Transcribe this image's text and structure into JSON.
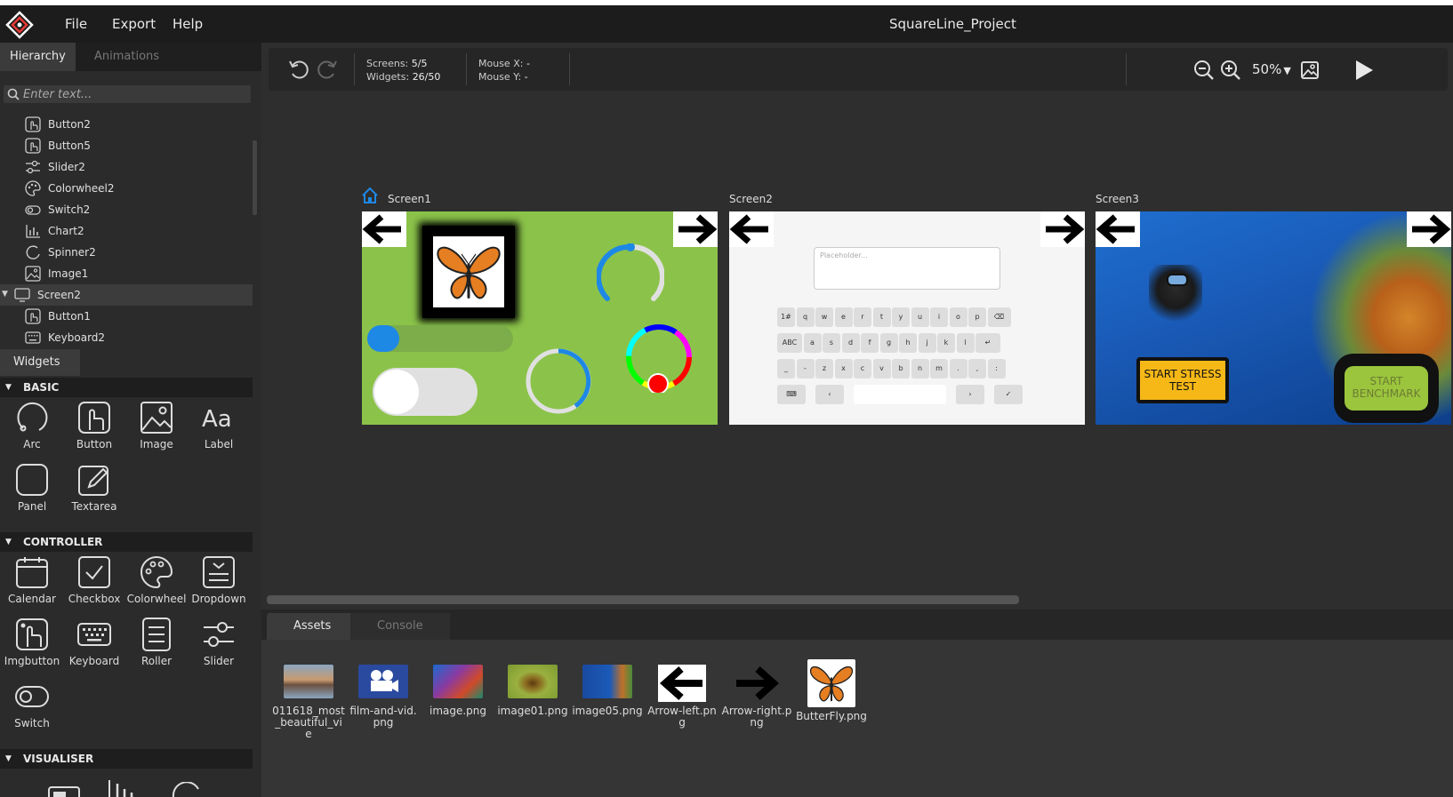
{
  "app": {
    "title": "SquareLine_Project",
    "menu": [
      "File",
      "Export",
      "Help"
    ]
  },
  "left_panel": {
    "tabs": [
      "Hierarchy",
      "Animations"
    ],
    "search_placeholder": "Enter text...",
    "hierarchy": [
      {
        "label": "Button2",
        "icon": "button-icon"
      },
      {
        "label": "Button5",
        "icon": "button-icon"
      },
      {
        "label": "Slider2",
        "icon": "slider-icon"
      },
      {
        "label": "Colorwheel2",
        "icon": "colorwheel-icon"
      },
      {
        "label": "Switch2",
        "icon": "switch-icon"
      },
      {
        "label": "Chart2",
        "icon": "chart-icon"
      },
      {
        "label": "Spinner2",
        "icon": "spinner-icon"
      },
      {
        "label": "Image1",
        "icon": "image-icon"
      },
      {
        "label": "Screen2",
        "icon": "screen-icon",
        "selected": true
      },
      {
        "label": "Button1",
        "icon": "button-icon"
      },
      {
        "label": "Keyboard2",
        "icon": "keyboard-icon"
      }
    ],
    "widgets_tab": "Widgets",
    "sections": {
      "basic": "BASIC",
      "controller": "CONTROLLER",
      "visualiser": "VISUALISER"
    },
    "basic_widgets": [
      "Arc",
      "Button",
      "Image",
      "Label",
      "Panel",
      "Textarea"
    ],
    "controller_widgets": [
      "Calendar",
      "Checkbox",
      "Colorwheel",
      "Dropdown",
      "Imgbutton",
      "Keyboard",
      "Roller",
      "Slider",
      "Switch"
    ]
  },
  "toolbar": {
    "screens_label": "Screens:",
    "screens_value": "5/5",
    "widgets_label": "Widgets:",
    "widgets_value": "26/50",
    "mouse_x_label": "Mouse X:",
    "mouse_x_value": "-",
    "mouse_y_label": "Mouse Y:",
    "mouse_y_value": "-",
    "zoom": "50%"
  },
  "canvas": {
    "screens": [
      {
        "label": "Screen1",
        "home": true
      },
      {
        "label": "Screen2"
      },
      {
        "label": "Screen3"
      }
    ],
    "textarea_placeholder": "Placeholder...",
    "keyboard_rows": [
      [
        "1#",
        "q",
        "w",
        "e",
        "r",
        "t",
        "y",
        "u",
        "i",
        "o",
        "p",
        "⌫"
      ],
      [
        "ABC",
        "a",
        "s",
        "d",
        "f",
        "g",
        "h",
        "j",
        "k",
        "l",
        "↵"
      ],
      [
        "_",
        "-",
        "z",
        "x",
        "c",
        "v",
        "b",
        "n",
        "m",
        ".",
        ",",
        ":"
      ],
      [
        "⌨",
        "‹",
        " ",
        "›",
        "✓"
      ]
    ],
    "stress_button": "START STRESS TEST",
    "benchmark_button": "START BENCHMARK"
  },
  "bottom_panel": {
    "tabs": [
      "Assets",
      "Console"
    ],
    "assets": [
      {
        "name": "011618_most_beautiful_vie",
        "color": "#8a7a70"
      },
      {
        "name": "film-and-vid.png",
        "color": "#2a4aa0"
      },
      {
        "name": "image.png",
        "color": "#6a3a8a"
      },
      {
        "name": "image01.png",
        "color": "#8aa040"
      },
      {
        "name": "image05.png",
        "color": "#1a4a9a"
      },
      {
        "name": "Arrow-left.png",
        "color": "#ffffff"
      },
      {
        "name": "Arrow-right.png",
        "color": "#353535"
      },
      {
        "name": "ButterFly.png",
        "color": "#ffffff"
      }
    ]
  },
  "colors": {
    "accent": "#1e88e5",
    "screen1_bg": "#8bc34a",
    "button_yellow": "#f6b817",
    "benchmark_green": "#9bc53d"
  }
}
